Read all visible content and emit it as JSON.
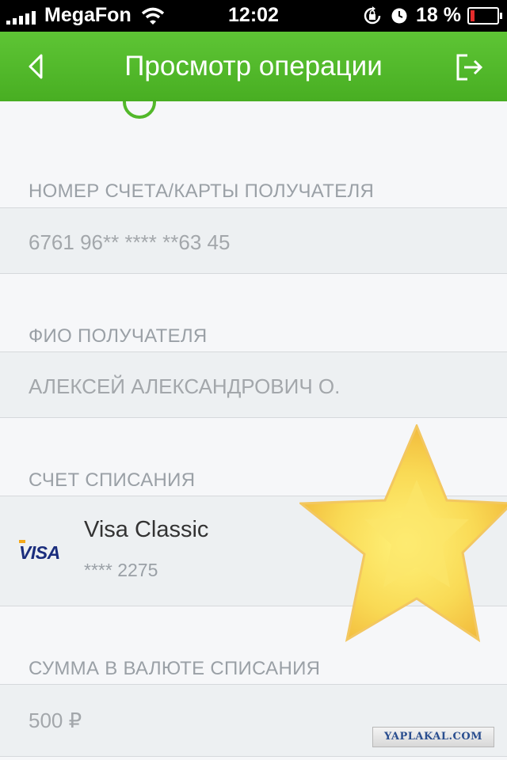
{
  "status_bar": {
    "carrier": "MegaFon",
    "time": "12:02",
    "battery_percent": "18 %"
  },
  "header": {
    "title": "Просмотр операции",
    "back_icon": "chevron-left-icon",
    "exit_icon": "logout-icon"
  },
  "sections": {
    "recipient_account": {
      "label": "НОМЕР СЧЕТА/КАРТЫ ПОЛУЧАТЕЛЯ",
      "value": "6761 96** **** **63 45"
    },
    "recipient_name": {
      "label": "ФИО ПОЛУЧАТЕЛЯ",
      "value": "АЛЕКСЕЙ АЛЕКСАНДРОВИЧ О."
    },
    "debit_account": {
      "label": "СЧЕТ СПИСАНИЯ",
      "card_logo": "VISA",
      "card_name": "Visa Classic",
      "card_number": "**** 2275"
    },
    "amount": {
      "label": "СУММА В ВАЛЮТЕ СПИСАНИЯ",
      "value": "500 ₽"
    }
  },
  "watermark": "YAPLAKAL.COM",
  "colors": {
    "header_green": "#52b82a",
    "background": "#f6f7f9",
    "field_background": "#edf0f2",
    "visa_blue": "#1a2d7d",
    "battery_low": "#e52c2c",
    "star_yellow": "#f7d44a"
  }
}
